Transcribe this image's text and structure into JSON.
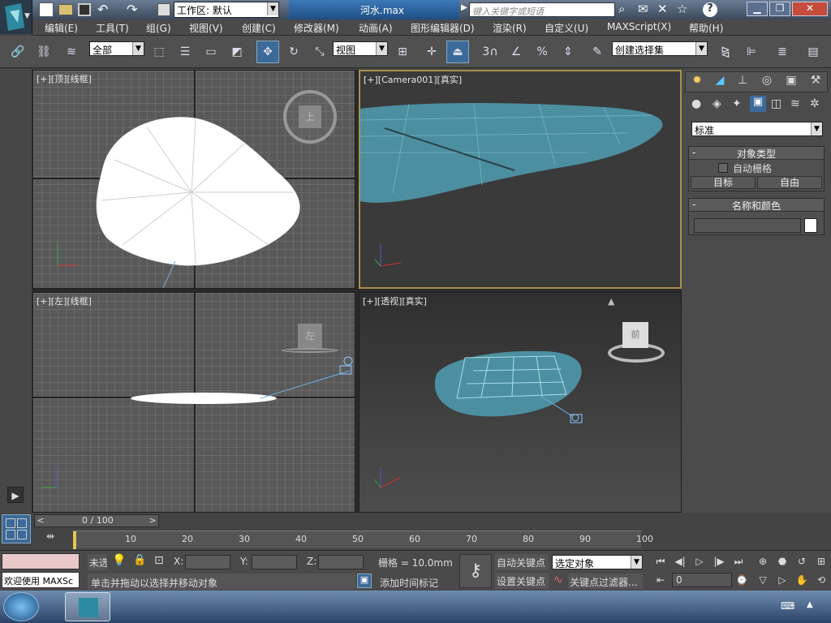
{
  "window": {
    "workspace_label": "工作区: 默认",
    "file_title": "河水.max",
    "search_placeholder": "键入关键字或短语"
  },
  "menu": [
    "编辑(E)",
    "工具(T)",
    "组(G)",
    "视图(V)",
    "创建(C)",
    "修改器(M)",
    "动画(A)",
    "图形编辑器(D)",
    "渲染(R)",
    "自定义(U)",
    "MAXScript(X)",
    "帮助(H)"
  ],
  "toolbar": {
    "selection_filter": "全部",
    "ref_coord": "视图",
    "snap_label": "3",
    "named_selection": "创建选择集"
  },
  "viewports": {
    "top": {
      "label": "[+][顶][线框]",
      "cube_face": "上"
    },
    "camera": {
      "label": "[+][Camera001][真实]"
    },
    "left": {
      "label": "[+][左][线框]",
      "cube_face": "左"
    },
    "persp": {
      "label": "[+][透视][真实]",
      "cube_face": "前"
    }
  },
  "command_panel": {
    "category": "标准",
    "rollout_object_type": "对象类型",
    "autogrid_label": "自动栅格",
    "btn_target": "目标",
    "btn_free": "自由",
    "rollout_name_color": "名称和颜色",
    "accent_color": "#3c6a9a",
    "swatch_color": "#ffffff"
  },
  "timeline": {
    "frame_display": "0 / 100",
    "ticks": [
      "10",
      "20",
      "30",
      "40",
      "50",
      "60",
      "70",
      "80",
      "90",
      "100"
    ]
  },
  "status": {
    "welcome": "欢迎使用 MAXSc",
    "selection_state": "未选",
    "x_label": "X:",
    "y_label": "Y:",
    "z_label": "Z:",
    "grid_label": "栅格 = 10.0mm",
    "prompt": "单击并拖动以选择并移动对象",
    "add_time_tag": "添加时间标记",
    "auto_key": "自动关键点",
    "set_key": "设置关键点",
    "key_target": "选定对象",
    "key_filters": "关键点过滤器...",
    "frame_value": "0"
  }
}
